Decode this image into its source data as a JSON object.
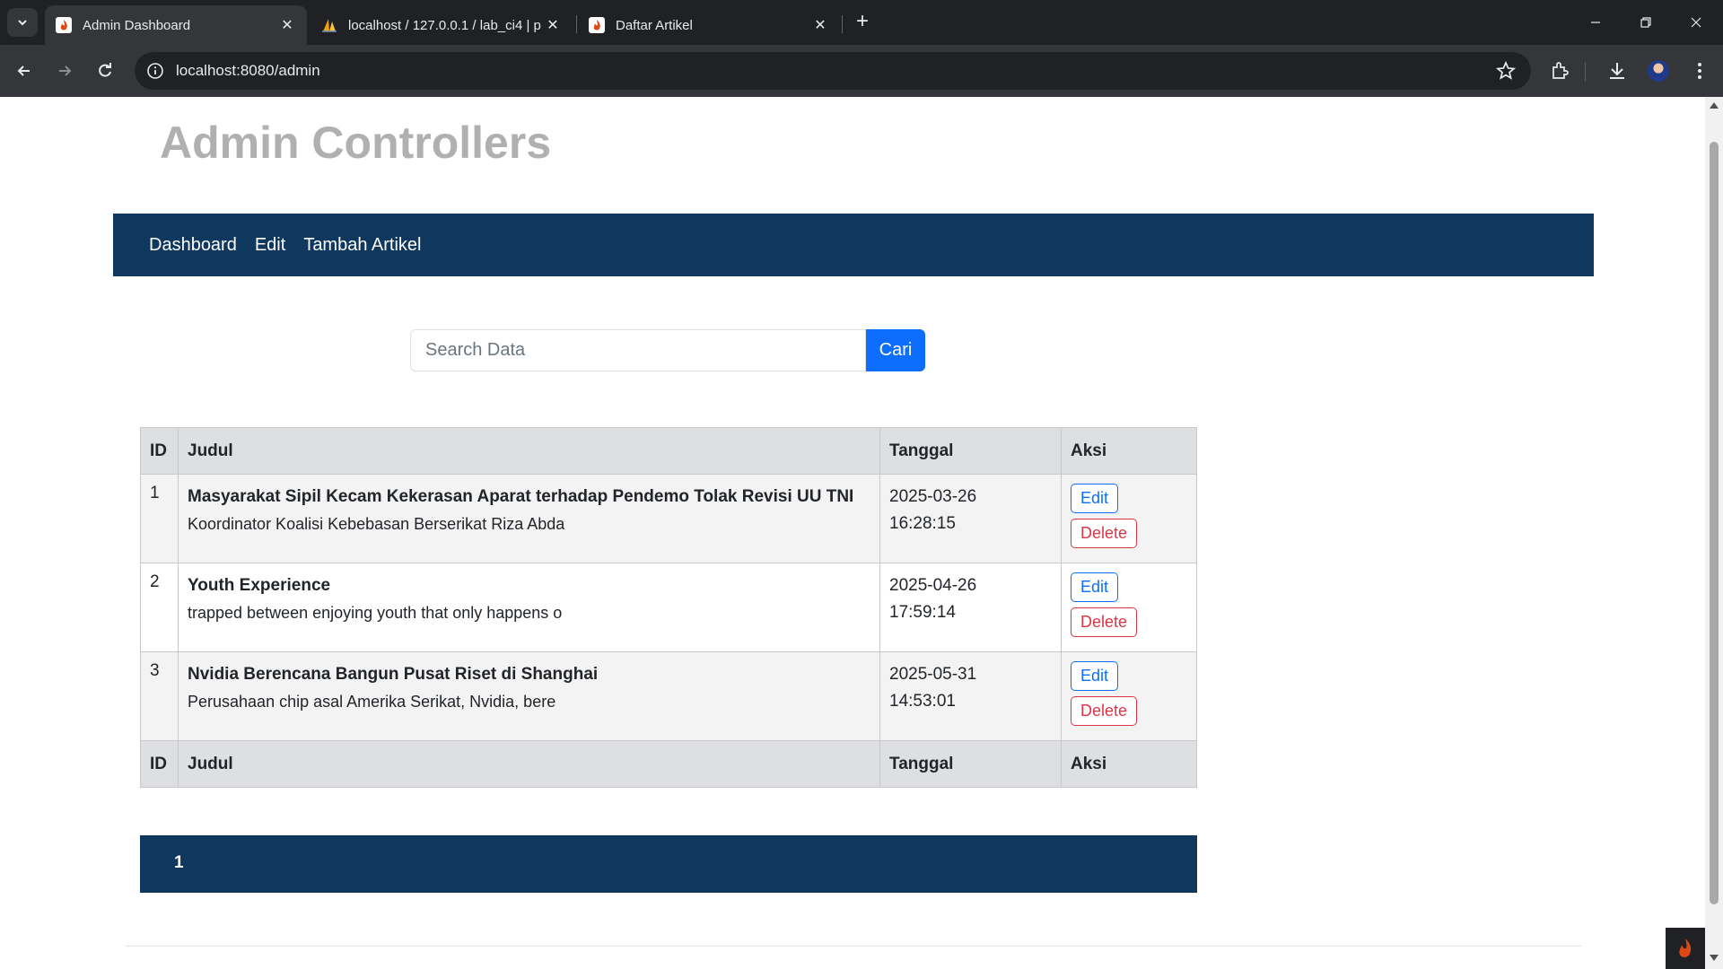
{
  "browser": {
    "tabs": [
      {
        "title": "Admin Dashboard",
        "active": true,
        "icon": "codeigniter-flame-icon"
      },
      {
        "title": "localhost / 127.0.0.1 / lab_ci4 | p",
        "active": false,
        "icon": "phpmyadmin-sail-icon"
      },
      {
        "title": "Daftar Artikel",
        "active": false,
        "icon": "codeigniter-flame-icon"
      }
    ],
    "url": "localhost:8080/admin"
  },
  "site": {
    "title": "Admin Controllers",
    "nav": [
      "Dashboard",
      "Edit",
      "Tambah Artikel"
    ],
    "nav_bg": "#10375e"
  },
  "search": {
    "placeholder": "Search Data",
    "value": "",
    "button": "Cari"
  },
  "table": {
    "headers": [
      "ID",
      "Judul",
      "Tanggal",
      "Aksi"
    ],
    "rows": [
      {
        "id": "1",
        "title": "Masyarakat Sipil Kecam Kekerasan Aparat terhadap Pendemo Tolak Revisi UU TNI",
        "excerpt": "Koordinator Koalisi Kebebasan Berserikat Riza Abda",
        "date": "2025-03-26",
        "time": "16:28:15",
        "edit": "Edit",
        "delete": "Delete"
      },
      {
        "id": "2",
        "title": "Youth Experience",
        "excerpt": "trapped between enjoying youth that only happens o",
        "date": "2025-04-26",
        "time": "17:59:14",
        "edit": "Edit",
        "delete": "Delete"
      },
      {
        "id": "3",
        "title": "Nvidia Berencana Bangun Pusat Riset di Shanghai",
        "excerpt": "Perusahaan chip asal Amerika Serikat, Nvidia, bere",
        "date": "2025-05-31",
        "time": "14:53:01",
        "edit": "Edit",
        "delete": "Delete"
      }
    ]
  },
  "pagination": {
    "current": "1"
  },
  "colors": {
    "accent": "#0d6efd",
    "danger": "#dc3545",
    "header_gray": "#dedfe3"
  }
}
